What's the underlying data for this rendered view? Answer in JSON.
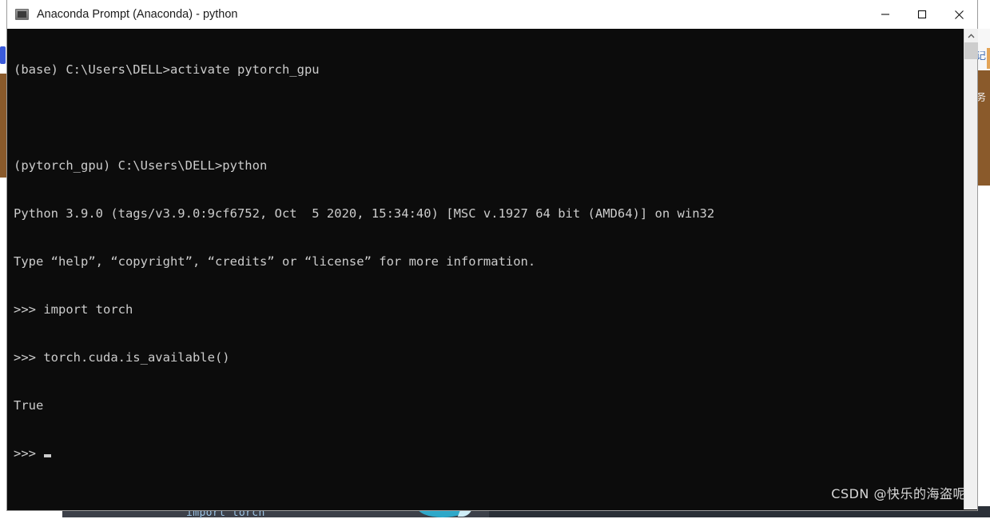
{
  "window": {
    "title": "Anaconda Prompt (Anaconda) - python",
    "icon": "console-icon",
    "controls": {
      "minimize": "minimize-icon",
      "maximize": "maximize-icon",
      "close": "close-icon"
    }
  },
  "terminal": {
    "background_color": "#0c0c0c",
    "foreground_color": "#cccccc",
    "lines": [
      "(base) C:\\Users\\DELL>activate pytorch_gpu",
      "",
      "(pytorch_gpu) C:\\Users\\DELL>python",
      "Python 3.9.0 (tags/v3.9.0:9cf6752, Oct  5 2020, 15:34:40) [MSC v.1927 64 bit (AMD64)] on win32",
      "Type “help”, “copyright”, “credits” or “license” for more information.",
      ">>> import torch",
      ">>> torch.cuda.is_available()",
      "True",
      ">>> "
    ],
    "prompt_symbol": ">>>",
    "last_result": "True"
  },
  "scrollbar": {
    "up_arrow": "chevron-up-icon",
    "thumb_label": "scroll-thumb"
  },
  "background": {
    "editor_code": "import torch",
    "right_glyph_1": "记",
    "right_glyph_2": "务"
  },
  "watermark": {
    "text": "CSDN @快乐的海盗呢"
  }
}
